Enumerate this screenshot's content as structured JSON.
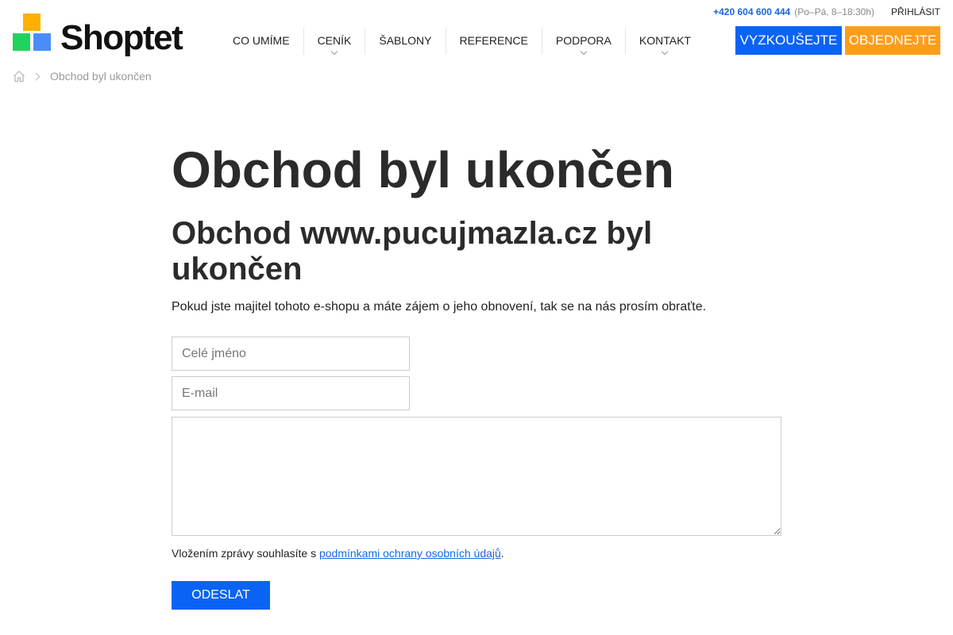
{
  "brand": {
    "name": "Shoptet",
    "colors": {
      "yellow": "#ffb000",
      "green": "#1fd35c",
      "blue": "#4a8df8",
      "primary": "#0b63f6",
      "accent": "#ff9d1b",
      "link": "#1a66e0"
    }
  },
  "topbar": {
    "phone": "+420 604 600 444",
    "hours": "(Po–Pá, 8–18:30h)",
    "login": "PŘIHLÁSIT"
  },
  "nav": {
    "items": [
      {
        "label": "CO UMÍME",
        "has_dropdown": false
      },
      {
        "label": "CENÍK",
        "has_dropdown": true
      },
      {
        "label": "ŠABLONY",
        "has_dropdown": false
      },
      {
        "label": "REFERENCE",
        "has_dropdown": false
      },
      {
        "label": "PODPORA",
        "has_dropdown": true
      },
      {
        "label": "KONTAKT",
        "has_dropdown": true
      }
    ]
  },
  "cta": {
    "try_label": "VYZKOUŠEJTE",
    "order_label": "OBJEDNEJTE"
  },
  "breadcrumb": {
    "home_icon": "home-icon",
    "current": "Obchod byl ukončen"
  },
  "main": {
    "title": "Obchod byl ukončen",
    "subtitle": "Obchod www.pucujmazla.cz byl ukončen",
    "lead": "Pokud jste majitel tohoto e-shopu a máte zájem o jeho obnovení, tak se na nás prosím obraťte."
  },
  "form": {
    "name_placeholder": "Celé jméno",
    "name_value": "",
    "email_placeholder": "E-mail",
    "email_value": "",
    "message_value": "",
    "consent_prefix": "Vložením zprávy souhlasíte s ",
    "consent_link": "podmínkami ochrany osobních údajů",
    "consent_suffix": ".",
    "submit_label": "ODESLAT"
  }
}
